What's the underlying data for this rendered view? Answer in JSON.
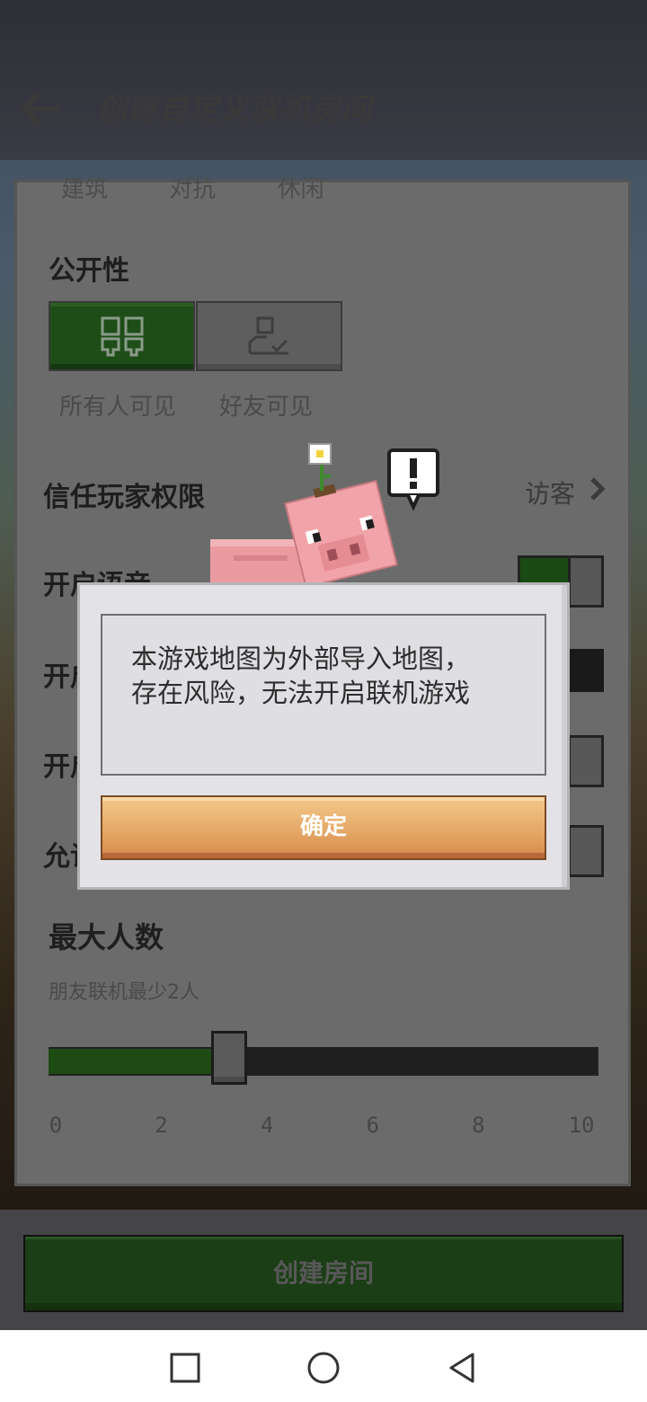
{
  "header": {
    "title": "创建自定义联机房间"
  },
  "categories": [
    "建筑",
    "对抗",
    "休闲"
  ],
  "visibility": {
    "label": "公开性",
    "options": [
      "所有人可见",
      "好友可见"
    ],
    "selected": "所有人可见"
  },
  "trust": {
    "label": "信任玩家权限",
    "value": "访客"
  },
  "settings": [
    {
      "label": "开启语音",
      "state": "on"
    },
    {
      "label": "开启",
      "state": "off"
    },
    {
      "label": "开启",
      "state": "off"
    },
    {
      "label": "允许",
      "state": "off"
    }
  ],
  "max_players": {
    "label": "最大人数",
    "subtitle": "朋友联机最少2人",
    "value": 4,
    "min": 0,
    "max": 10,
    "ticks": [
      "0",
      "2",
      "4",
      "6",
      "8",
      "10"
    ]
  },
  "create_button": {
    "label": "创建房间"
  },
  "dialog": {
    "message": "本游戏地图为外部导入地图，\n存在风险，无法开启联机游戏",
    "confirm_label": "确定"
  },
  "colors": {
    "accent_green": "#1e4a14",
    "dialog_button": "#e5a867",
    "dialog_bg": "#e3e3e7"
  },
  "nav": {
    "icons": [
      "square-icon",
      "circle-icon",
      "triangle-back-icon"
    ]
  }
}
